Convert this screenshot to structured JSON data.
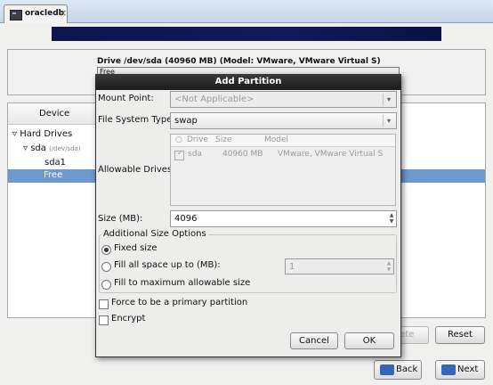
{
  "window": {
    "tab_title": "oracledb",
    "tab_close": "×"
  },
  "drive": {
    "title": "Drive /dev/sda (40960 MB) (Model: VMware, VMware Virtual S)",
    "bar_label": "Free"
  },
  "tree": {
    "header": "Device",
    "items": [
      {
        "label": "Hard Drives",
        "expanded": true
      },
      {
        "label": "sda",
        "sublabel": "(/dev/sda)",
        "expanded": true
      },
      {
        "label": "sda1"
      },
      {
        "label": "Free",
        "selected": true
      }
    ]
  },
  "buttons": {
    "delete": "Delete",
    "reset": "Reset",
    "back": "Back",
    "next": "Next"
  },
  "dialog": {
    "title": "Add Partition",
    "mount_point": {
      "label": "Mount Point:",
      "value": "<Not Applicable>"
    },
    "fs_type": {
      "label": "File System Type:",
      "value": "swap"
    },
    "allowable_drives": {
      "label": "Allowable Drives:",
      "columns": [
        "Drive",
        "Size",
        "Model"
      ],
      "rows": [
        {
          "checked": true,
          "drive": "sda",
          "size": "40960 MB",
          "model": "VMware, VMware Virtual S"
        }
      ]
    },
    "size": {
      "label": "Size (MB):",
      "value": "4096"
    },
    "size_options": {
      "title": "Additional Size Options",
      "fixed": "Fixed size",
      "fill_up_to": "Fill all space up to (MB):",
      "fill_up_to_value": "1",
      "fill_max": "Fill to maximum allowable size",
      "selected": "fixed"
    },
    "primary": {
      "label": "Force to be a primary partition",
      "checked": false
    },
    "encrypt": {
      "label": "Encrypt",
      "checked": false
    },
    "cancel": "Cancel",
    "ok": "OK"
  },
  "colors": {
    "selection": "#6e98cf",
    "banner": "#101a5c",
    "titlebar": "#1b1b1b"
  }
}
